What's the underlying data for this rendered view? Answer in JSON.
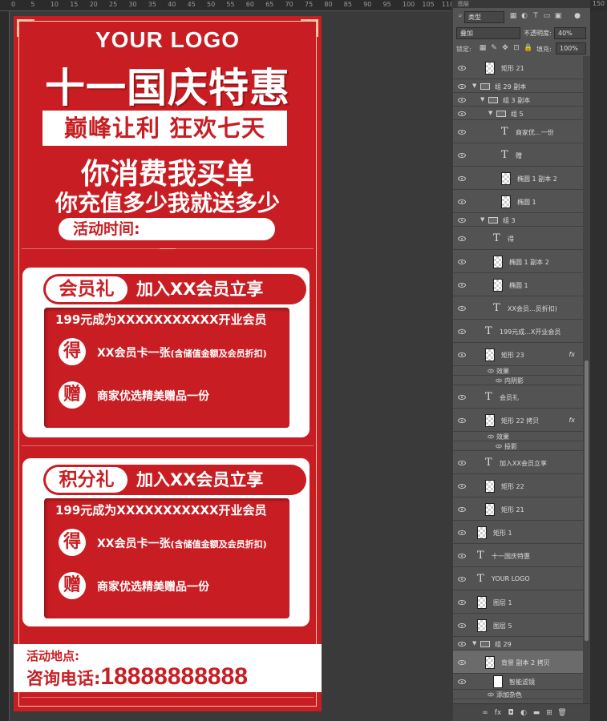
{
  "ruler": {
    "top_ticks": [
      "0",
      "5",
      "10",
      "15",
      "20",
      "25",
      "30",
      "35",
      "40",
      "45",
      "50",
      "55",
      "60",
      "65",
      "70",
      "75",
      "80",
      "85",
      "90",
      "95",
      "100",
      "105",
      "110"
    ],
    "right_tick": "150"
  },
  "poster": {
    "logo": "YOUR LOGO",
    "headline": "十一国庆特惠",
    "banner": "巅峰让利 狂欢七天",
    "slogan1": "你消费我买单",
    "slogan2": "你充值多少我就送多少",
    "time_label": "活动时间:",
    "cards": [
      {
        "tag": "会员礼",
        "tag_text": "加入XX会员立享",
        "inner_title": "199元成为XXXXXXXXXXX开业会员",
        "rows": [
          {
            "badge": "得",
            "text": "XX会员卡一张",
            "small": "(含储值金额及会员折扣)"
          },
          {
            "badge": "赠",
            "text": "商家优选精美赠品一份",
            "small": ""
          }
        ]
      },
      {
        "tag": "积分礼",
        "tag_text": "加入XX会员立享",
        "inner_title": "199元成为XXXXXXXXXXX开业会员",
        "rows": [
          {
            "badge": "得",
            "text": "XX会员卡一张",
            "small": "(含储值金额及会员折扣)"
          },
          {
            "badge": "赠",
            "text": "商家优选精美赠品一份",
            "small": ""
          }
        ]
      }
    ],
    "footer_place": "活动地点:",
    "footer_phone_label": "咨询电话:",
    "footer_phone": "18888888888"
  },
  "panel": {
    "header": "图层",
    "filter_kind": "类型",
    "blend_mode": "叠加",
    "opacity_label": "不透明度:",
    "opacity_value": "40%",
    "lock_label": "锁定:",
    "fill_label": "填充:",
    "fill_value": "100%",
    "layers": [
      {
        "name": "矩形 21",
        "type": "shape",
        "indent": 1
      },
      {
        "name": "组 29 副本",
        "type": "group",
        "indent": 0
      },
      {
        "name": "组 3 副本",
        "type": "group",
        "indent": 1
      },
      {
        "name": "组 5",
        "type": "group",
        "indent": 2
      },
      {
        "name": "商家优...一份",
        "type": "text",
        "indent": 3
      },
      {
        "name": "赠",
        "type": "text",
        "indent": 3
      },
      {
        "name": "椭圆 1 副本 2",
        "type": "shape",
        "indent": 3
      },
      {
        "name": "椭圆 1",
        "type": "shape",
        "indent": 3
      },
      {
        "name": "组 3",
        "type": "group",
        "indent": 1
      },
      {
        "name": "得",
        "type": "text",
        "indent": 2
      },
      {
        "name": "椭圆 1 副本 2",
        "type": "shape",
        "indent": 2
      },
      {
        "name": "椭圆 1",
        "type": "shape",
        "indent": 2
      },
      {
        "name": "XX会员...员折扣)",
        "type": "text",
        "indent": 2
      },
      {
        "name": "199元成...X开业会员",
        "type": "text",
        "indent": 1
      },
      {
        "name": "矩形 23",
        "type": "shape",
        "indent": 1,
        "fx": "fx"
      },
      {
        "name": "效果",
        "type": "effect",
        "indent": 2
      },
      {
        "name": "内阴影",
        "type": "effect",
        "indent": 3
      },
      {
        "name": "会员礼",
        "type": "text",
        "indent": 1
      },
      {
        "name": "矩形 22 拷贝",
        "type": "shape",
        "indent": 1,
        "fx": "fx"
      },
      {
        "name": "效果",
        "type": "effect",
        "indent": 2
      },
      {
        "name": "投影",
        "type": "effect",
        "indent": 3
      },
      {
        "name": "加入XX会员立享",
        "type": "text",
        "indent": 1
      },
      {
        "name": "矩形 22",
        "type": "shape",
        "indent": 1
      },
      {
        "name": "矩形 21",
        "type": "shape",
        "indent": 1
      },
      {
        "name": "矩形 1",
        "type": "shape",
        "indent": 0
      },
      {
        "name": "十一国庆特惠",
        "type": "text",
        "indent": 0
      },
      {
        "name": "YOUR LOGO",
        "type": "text",
        "indent": 0
      },
      {
        "name": "图层 1",
        "type": "shape",
        "indent": 0
      },
      {
        "name": "图层 5",
        "type": "shape",
        "indent": 0
      },
      {
        "name": "组 29",
        "type": "group",
        "indent": 0
      },
      {
        "name": "背景 副本 2 拷贝",
        "type": "smart",
        "indent": 1
      },
      {
        "name": "智能滤镜",
        "type": "filter",
        "indent": 2
      },
      {
        "name": "添加杂色",
        "type": "effect",
        "indent": 2
      }
    ]
  },
  "icons": {
    "search": "search-icon",
    "eye": "eye-icon",
    "folder": "folder-icon",
    "text_layer": "text-layer-icon"
  },
  "colors": {
    "poster_red": "#c81e23",
    "panel_bg": "#535353"
  }
}
